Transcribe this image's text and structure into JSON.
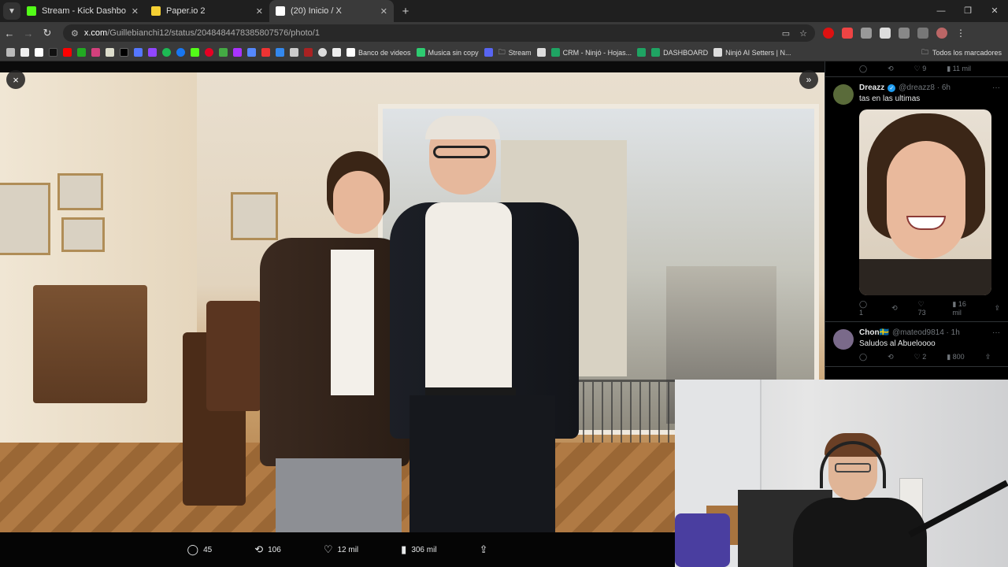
{
  "browser": {
    "tabs": [
      {
        "title": "Stream - Kick Dashboard",
        "favicon_color": "#53fc18",
        "active": false
      },
      {
        "title": "Paper.io 2",
        "favicon_color": "#f5d033",
        "active": false
      },
      {
        "title": "(20) Inicio / X",
        "favicon_color": "#ffffff",
        "active": true
      }
    ],
    "url_host": "x.com",
    "url_path": "/Guillebianchi12/status/2048484478385807576/photo/1",
    "bookmarks": [
      {
        "label": "Banco de videos",
        "icon_color": "#ffffff"
      },
      {
        "label": "Musica sin copy",
        "icon_color": "#2ecc71"
      },
      {
        "label": "Stream",
        "icon_color": "#cccccc"
      },
      {
        "label": "CRM - Ninjó - Hojas...",
        "icon_color": "#1fa463"
      },
      {
        "label": "DASHBOARD",
        "icon_color": "#1fa463"
      },
      {
        "label": "Ninjó AI Setters | N...",
        "icon_color": "#dddddd"
      }
    ],
    "all_bookmarks_label": "Todos los marcadores"
  },
  "post_actions": {
    "replies": "45",
    "reposts": "106",
    "likes": "12 mil",
    "views": "306 mil"
  },
  "top_reply_stats": {
    "replies": "9",
    "views": "11 mil"
  },
  "replies": [
    {
      "name": "Dreazz",
      "handle": "@dreazz8 · 6h",
      "verified": true,
      "text": "tas en las ultimas",
      "stats": {
        "replies": "1",
        "reposts": "",
        "likes": "73",
        "views": "16 mil"
      },
      "avatar_color": "#5a6b3a"
    },
    {
      "name": "Chon🇸🇪",
      "handle": "@mateod9814 · 1h",
      "verified": false,
      "text": "Saludos al Abueloooo",
      "stats": {
        "replies": "",
        "reposts": "",
        "likes": "2",
        "views": "800"
      },
      "avatar_color": "#7a6a8a"
    }
  ],
  "icons": {
    "close": "×",
    "expand": "»",
    "reply": "💬",
    "repost": "⟲",
    "like": "♡",
    "views": "▮",
    "share": "⇪"
  }
}
